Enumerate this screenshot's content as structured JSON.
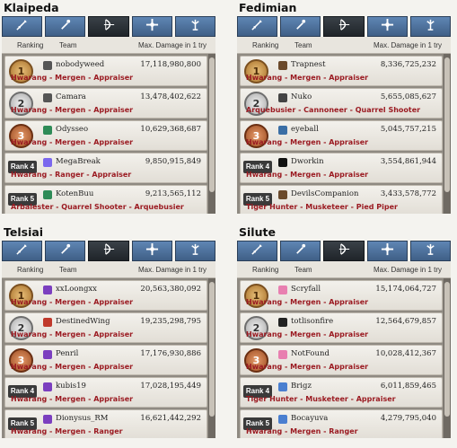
{
  "column_headers": {
    "ranking": "Ranking",
    "team": "Team",
    "damage": "Max. Damage in 1 try"
  },
  "tabs": [
    {
      "icon": "sword-icon",
      "active": false
    },
    {
      "icon": "wand-icon",
      "active": false
    },
    {
      "icon": "bow-icon",
      "active": true
    },
    {
      "icon": "cross-icon",
      "active": false
    },
    {
      "icon": "statue-icon",
      "active": false
    }
  ],
  "panels": [
    {
      "server": "Klaipeda",
      "rows": [
        {
          "rank": "1",
          "rank_label": "",
          "team": "nobodyweed",
          "damage": "17,118,980,800",
          "classes": "Hwarang - Mergen - Appraiser",
          "icon_color": "#555555"
        },
        {
          "rank": "2",
          "rank_label": "",
          "team": "Camara",
          "damage": "13,478,402,622",
          "classes": "Hwarang - Mergen - Appraiser",
          "icon_color": "#555555"
        },
        {
          "rank": "3",
          "rank_label": "",
          "team": "Odysseo",
          "damage": "10,629,368,687",
          "classes": "Hwarang - Mergen - Appraiser",
          "icon_color": "#2e8b57"
        },
        {
          "rank": "4",
          "rank_label": "Rank 4",
          "team": "MegaBreak",
          "damage": "9,850,915,849",
          "classes": "Hwarang - Ranger - Appraiser",
          "icon_color": "#7b68ee"
        },
        {
          "rank": "5",
          "rank_label": "Rank 5",
          "team": "KotenBuu",
          "damage": "9,213,565,112",
          "classes": "Arbalester - Quarrel Shooter - Arquebusier",
          "icon_color": "#2e8b57"
        }
      ]
    },
    {
      "server": "Fedimian",
      "rows": [
        {
          "rank": "1",
          "rank_label": "",
          "team": "Trapnest",
          "damage": "8,336,725,232",
          "classes": "Hwarang - Mergen - Appraiser",
          "icon_color": "#6b4a2b"
        },
        {
          "rank": "2",
          "rank_label": "",
          "team": "Nuko",
          "damage": "5,655,085,627",
          "classes": "Arquebusier - Cannoneer - Quarrel Shooter",
          "icon_color": "#444444"
        },
        {
          "rank": "3",
          "rank_label": "",
          "team": "eyeball",
          "damage": "5,045,757,215",
          "classes": "Hwarang - Mergen - Appraiser",
          "icon_color": "#3a6ea5"
        },
        {
          "rank": "4",
          "rank_label": "Rank 4",
          "team": "Dworkin",
          "damage": "3,554,861,944",
          "classes": "Hwarang - Mergen - Appraiser",
          "icon_color": "#111111"
        },
        {
          "rank": "5",
          "rank_label": "Rank 5",
          "team": "DevilsCompanion",
          "damage": "3,433,578,772",
          "classes": "Tiger Hunter - Musketeer - Pied Piper",
          "icon_color": "#6b4a2b"
        }
      ]
    },
    {
      "server": "Telsiai",
      "rows": [
        {
          "rank": "1",
          "rank_label": "",
          "team": "xxLoongxx",
          "damage": "20,563,380,092",
          "classes": "Hwarang - Mergen - Appraiser",
          "icon_color": "#7b3fbf"
        },
        {
          "rank": "2",
          "rank_label": "",
          "team": "DestinedWing",
          "damage": "19,235,298,795",
          "classes": "Hwarang - Mergen - Appraiser",
          "icon_color": "#c0392b"
        },
        {
          "rank": "3",
          "rank_label": "",
          "team": "Penril",
          "damage": "17,176,930,886",
          "classes": "Hwarang - Mergen - Appraiser",
          "icon_color": "#7b3fbf"
        },
        {
          "rank": "4",
          "rank_label": "Rank 4",
          "team": "kubis19",
          "damage": "17,028,195,449",
          "classes": "Hwarang - Mergen - Appraiser",
          "icon_color": "#7b3fbf"
        },
        {
          "rank": "5",
          "rank_label": "Rank 5",
          "team": "Dionysus_RM",
          "damage": "16,621,442,292",
          "classes": "Hwarang - Mergen - Ranger",
          "icon_color": "#7b3fbf"
        }
      ]
    },
    {
      "server": "Silute",
      "rows": [
        {
          "rank": "1",
          "rank_label": "",
          "team": "Scryfall",
          "damage": "15,174,064,727",
          "classes": "Hwarang - Mergen - Appraiser",
          "icon_color": "#e87fb0"
        },
        {
          "rank": "2",
          "rank_label": "",
          "team": "totlisonfire",
          "damage": "12,564,679,857",
          "classes": "Hwarang - Mergen - Appraiser",
          "icon_color": "#222222"
        },
        {
          "rank": "3",
          "rank_label": "",
          "team": "NotFound",
          "damage": "10,028,412,367",
          "classes": "Hwarang - Mergen - Appraiser",
          "icon_color": "#e87fb0"
        },
        {
          "rank": "4",
          "rank_label": "Rank 4",
          "team": "Brigz",
          "damage": "6,011,859,465",
          "classes": "Tiger Hunter - Musketeer - Appraiser",
          "icon_color": "#4a7fd0"
        },
        {
          "rank": "5",
          "rank_label": "Rank 5",
          "team": "Bocayuva",
          "damage": "4,279,795,040",
          "classes": "Hwarang - Mergen - Ranger",
          "icon_color": "#4a7fd0"
        }
      ]
    }
  ]
}
